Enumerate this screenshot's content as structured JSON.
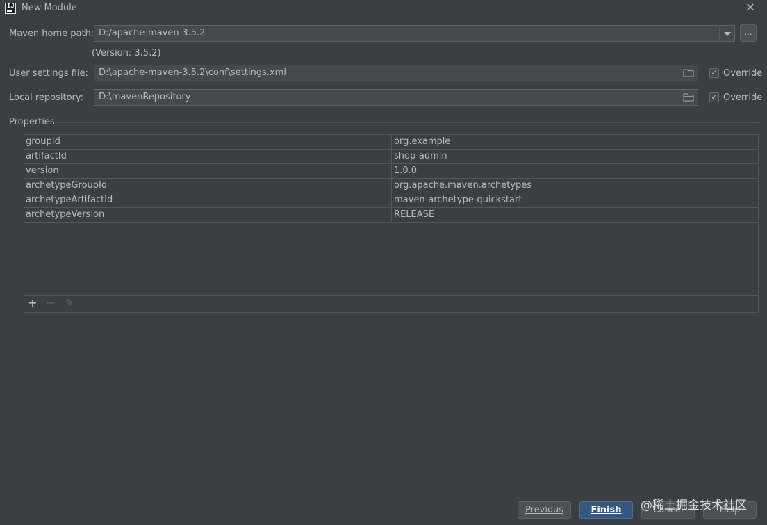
{
  "window": {
    "title": "New Module",
    "close_glyph": "✕"
  },
  "maven_home": {
    "label": "Maven home path:",
    "value": "D:/apache-maven-3.5.2",
    "version_note": "(Version: 3.5.2)",
    "browse_label": "..."
  },
  "user_settings": {
    "label": "User settings file:",
    "value": "D:\\apache-maven-3.5.2\\conf\\settings.xml",
    "override_label": "Override",
    "override_checked": true
  },
  "local_repo": {
    "label": "Local repository:",
    "value": "D:\\mavenRepository",
    "override_label": "Override",
    "override_checked": true
  },
  "properties": {
    "section_label": "Properties",
    "rows": [
      {
        "key": "groupId",
        "value": "org.example"
      },
      {
        "key": "artifactId",
        "value": "shop-admin"
      },
      {
        "key": "version",
        "value": "1.0.0"
      },
      {
        "key": "archetypeGroupId",
        "value": "org.apache.maven.archetypes"
      },
      {
        "key": "archetypeArtifactId",
        "value": "maven-archetype-quickstart"
      },
      {
        "key": "archetypeVersion",
        "value": "RELEASE"
      }
    ],
    "toolbar": {
      "add_glyph": "+",
      "remove_glyph": "−",
      "edit_glyph": "✎"
    }
  },
  "buttons": {
    "previous": "Previous",
    "finish": "Finish",
    "cancel": "Cancel",
    "help": "Help"
  },
  "watermark": "@稀土掘金技术社区",
  "colors": {
    "background": "#3c3f41",
    "field": "#45494a",
    "primary_button": "#365880",
    "text": "#bbbbbb"
  }
}
